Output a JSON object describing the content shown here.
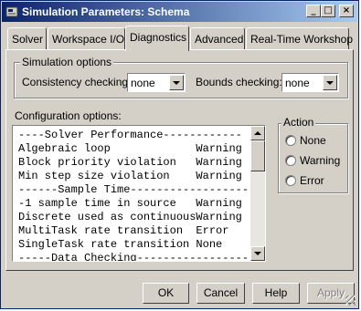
{
  "window": {
    "title": "Simulation Parameters: Schema",
    "minimize_glyph": "_",
    "maximize_glyph": "□",
    "close_glyph": "×"
  },
  "tabs": [
    {
      "label": "Solver"
    },
    {
      "label": "Workspace I/O"
    },
    {
      "label": "Diagnostics",
      "active": true
    },
    {
      "label": "Advanced"
    },
    {
      "label": "Real-Time Workshop"
    }
  ],
  "simulation_options": {
    "group_label": "Simulation options",
    "consistency_label": "Consistency checking:",
    "consistency_value": "none",
    "bounds_label": "Bounds checking:",
    "bounds_value": "none"
  },
  "configuration": {
    "group_label": "Configuration options:",
    "rows": [
      "----Solver Performance------------",
      "Algebraic loop             Warning",
      "Block priority violation   Warning",
      "Min step size violation    Warning",
      "------Sample Time------------------",
      "-1 sample time in source   Warning",
      "Discrete used as continuousWarning",
      "MultiTask rate transition  Error",
      "SingleTask rate transition None",
      "-----Data Checking-----------------"
    ]
  },
  "action": {
    "group_label": "Action",
    "options": [
      "None",
      "Warning",
      "Error"
    ]
  },
  "buttons": {
    "ok": "OK",
    "cancel": "Cancel",
    "help": "Help",
    "apply": "Apply"
  }
}
